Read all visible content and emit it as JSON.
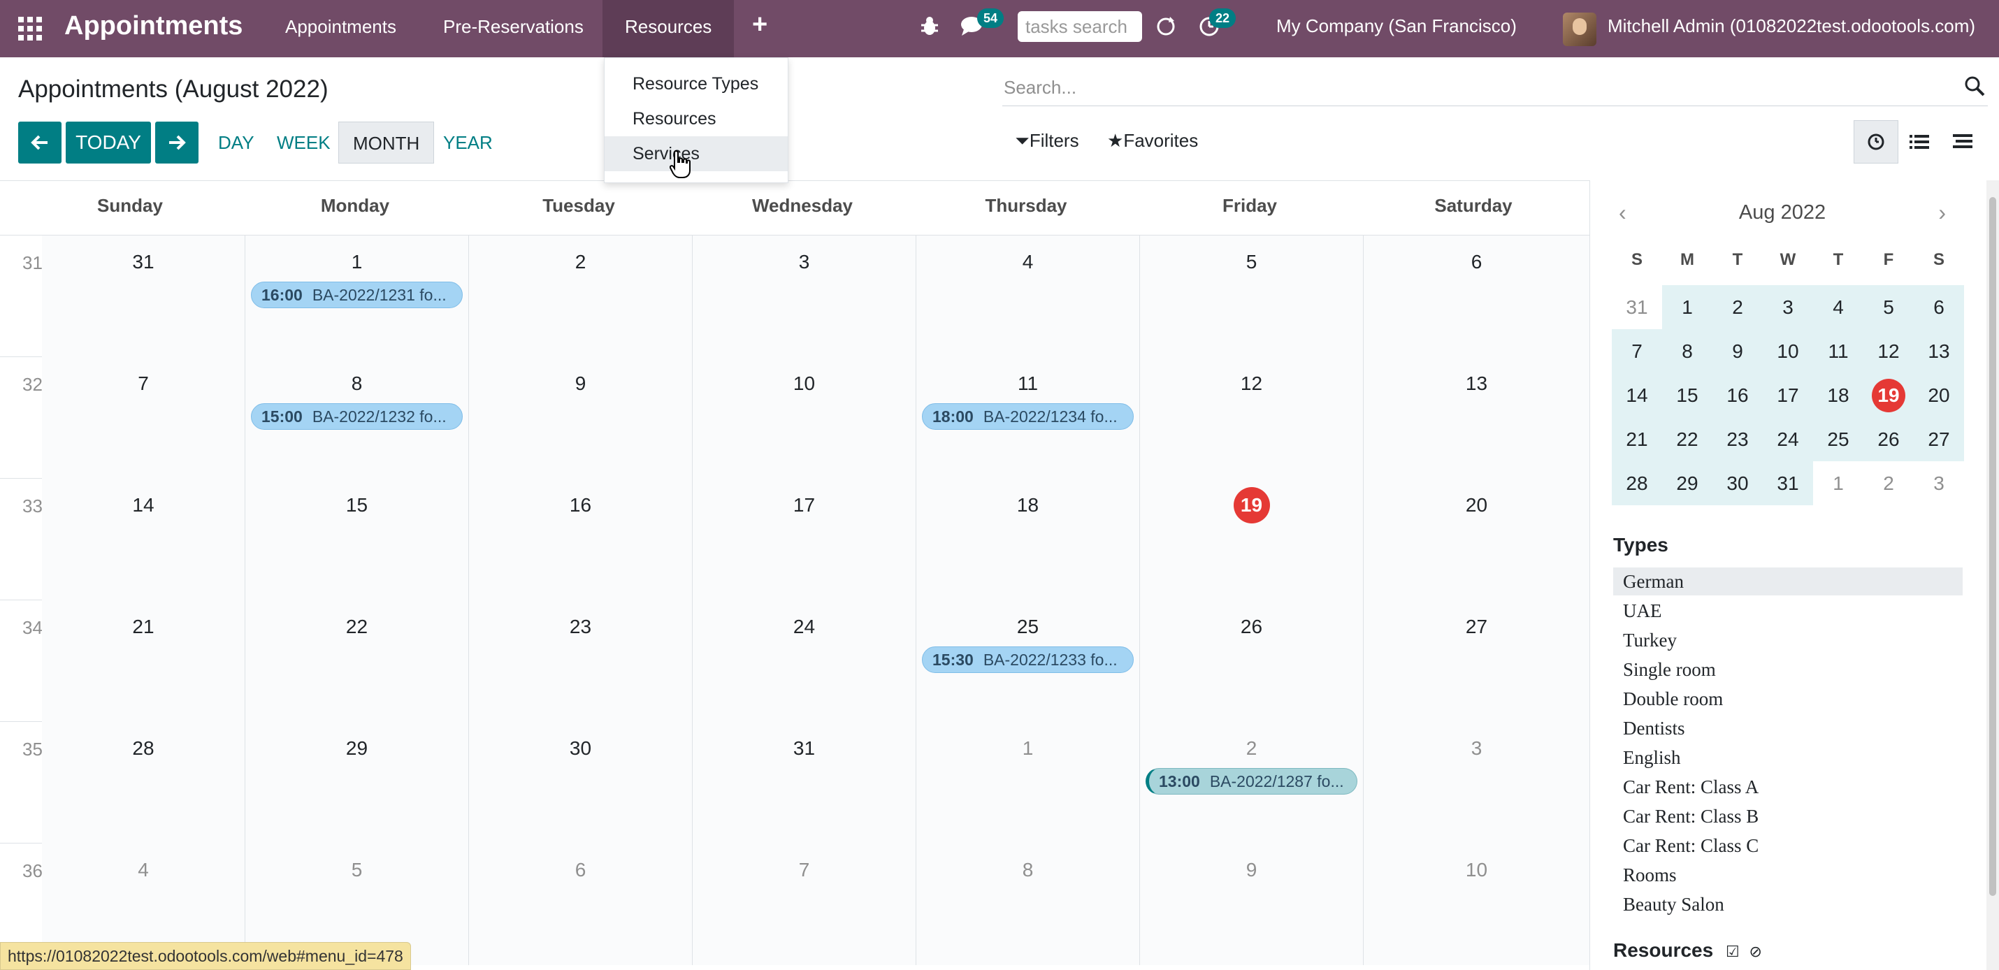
{
  "navbar": {
    "brand": "Appointments",
    "menu": [
      "Appointments",
      "Pre-Reservations",
      "Resources"
    ],
    "chat_badge": "54",
    "activity_badge": "22",
    "tasks_search_placeholder": "tasks search",
    "company": "My Company (San Francisco)",
    "user": "Mitchell Admin (01082022test.odootools.com)"
  },
  "dropdown": {
    "items": [
      "Resource Types",
      "Resources",
      "Services"
    ]
  },
  "control": {
    "title": "Appointments (August 2022)",
    "today": "TODAY",
    "scales": [
      "DAY",
      "WEEK",
      "MONTH",
      "YEAR"
    ],
    "search_placeholder": "Search...",
    "filters": "Filters",
    "favorites": "Favorites"
  },
  "calendar": {
    "dow": [
      "Sunday",
      "Monday",
      "Tuesday",
      "Wednesday",
      "Thursday",
      "Friday",
      "Saturday"
    ],
    "weeks": [
      {
        "num": "31",
        "days": [
          "31",
          "1",
          "2",
          "3",
          "4",
          "5",
          "6"
        ],
        "other": [
          false,
          false,
          false,
          false,
          false,
          false,
          false
        ]
      },
      {
        "num": "32",
        "days": [
          "7",
          "8",
          "9",
          "10",
          "11",
          "12",
          "13"
        ],
        "other": [
          false,
          false,
          false,
          false,
          false,
          false,
          false
        ]
      },
      {
        "num": "33",
        "days": [
          "14",
          "15",
          "16",
          "17",
          "18",
          "19",
          "20"
        ],
        "other": [
          false,
          false,
          false,
          false,
          false,
          false,
          false
        ]
      },
      {
        "num": "34",
        "days": [
          "21",
          "22",
          "23",
          "24",
          "25",
          "26",
          "27"
        ],
        "other": [
          false,
          false,
          false,
          false,
          false,
          false,
          false
        ]
      },
      {
        "num": "35",
        "days": [
          "28",
          "29",
          "30",
          "31",
          "1",
          "2",
          "3"
        ],
        "other": [
          false,
          false,
          false,
          false,
          true,
          true,
          true
        ]
      },
      {
        "num": "36",
        "days": [
          "4",
          "5",
          "6",
          "7",
          "8",
          "9",
          "10"
        ],
        "other": [
          true,
          true,
          true,
          true,
          true,
          true,
          true
        ]
      }
    ],
    "today": "19",
    "events": [
      {
        "week": 0,
        "day": 1,
        "time": "16:00",
        "title": "BA-2022/1231 fo..."
      },
      {
        "week": 1,
        "day": 1,
        "time": "15:00",
        "title": "BA-2022/1232 fo..."
      },
      {
        "week": 1,
        "day": 4,
        "time": "18:00",
        "title": "BA-2022/1234 fo..."
      },
      {
        "week": 3,
        "day": 4,
        "time": "15:30",
        "title": "BA-2022/1233 fo..."
      },
      {
        "week": 4,
        "day": 5,
        "time": "13:00",
        "title": "BA-2022/1287 fo...",
        "alt": true
      }
    ]
  },
  "mini_calendar": {
    "title": "Aug 2022",
    "dow": [
      "S",
      "M",
      "T",
      "W",
      "T",
      "F",
      "S"
    ],
    "rows": [
      [
        "31",
        "1",
        "2",
        "3",
        "4",
        "5",
        "6"
      ],
      [
        "7",
        "8",
        "9",
        "10",
        "11",
        "12",
        "13"
      ],
      [
        "14",
        "15",
        "16",
        "17",
        "18",
        "19",
        "20"
      ],
      [
        "21",
        "22",
        "23",
        "24",
        "25",
        "26",
        "27"
      ],
      [
        "28",
        "29",
        "30",
        "31",
        "1",
        "2",
        "3"
      ]
    ],
    "today": "19"
  },
  "sidebar": {
    "types_title": "Types",
    "types": [
      "German",
      "UAE",
      "Turkey",
      "Single room",
      "Double room",
      "Dentists",
      "English",
      "Car Rent: Class A",
      "Car Rent: Class B",
      "Car Rent: Class C",
      "Rooms",
      "Beauty Salon"
    ],
    "resources_title": "Resources"
  },
  "status_url": "https://01082022test.odootools.com/web#menu_id=478"
}
